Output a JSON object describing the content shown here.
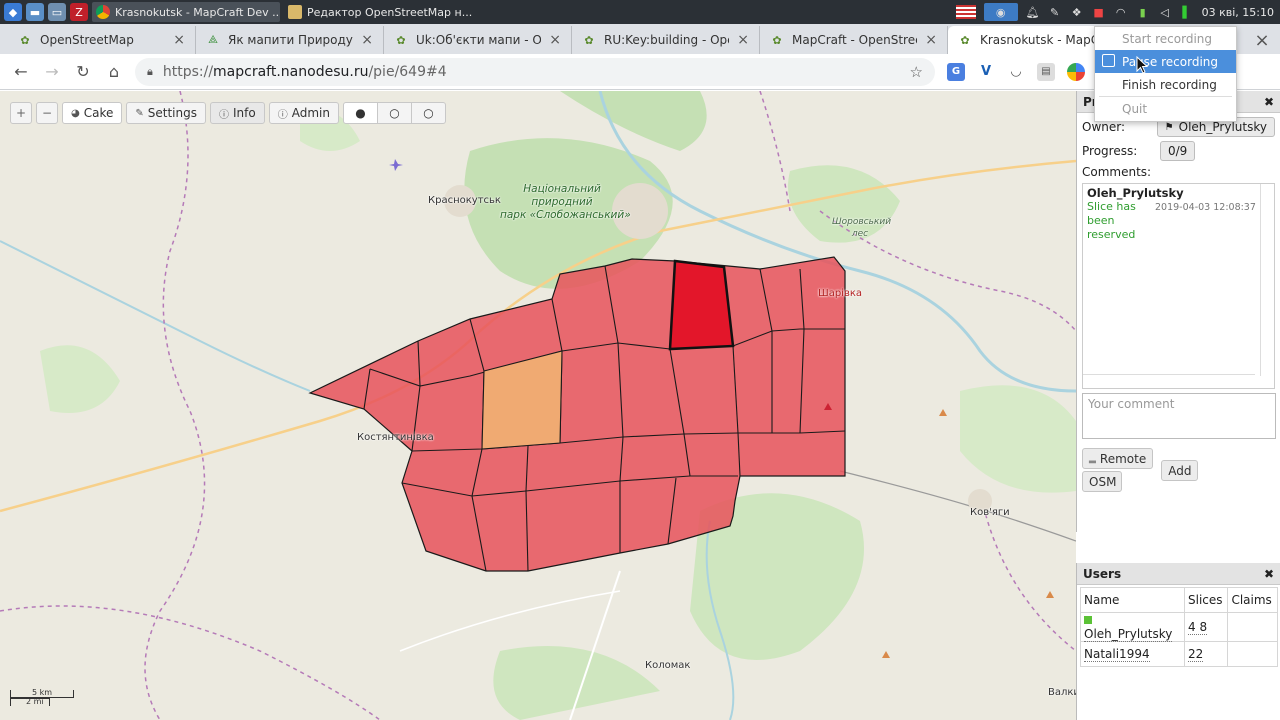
{
  "taskbar": {
    "tasks": [
      {
        "label": "Krasnokutsk - MapCraft Dev ..."
      },
      {
        "label": "Редактор OpenStreetMap н..."
      }
    ],
    "clock": "03 кві, 15:10"
  },
  "tabs": [
    {
      "label": "OpenStreetMap"
    },
    {
      "label": "Як мапити Природу в "
    },
    {
      "label": "Uk:Об'єкти мапи - Ope"
    },
    {
      "label": "RU:Key:building - OpenS"
    },
    {
      "label": "MapCraft - OpenStreetM"
    },
    {
      "label": "Krasnokutsk - MapCraft"
    }
  ],
  "address": {
    "scheme": "https://",
    "host": "mapcraft.nanodesu.ru",
    "path": "/pie/649#4"
  },
  "map_toolbar": {
    "zoom_in": "+",
    "zoom_out": "−",
    "cake": "Cake",
    "settings": "Settings",
    "info": "Info",
    "admin": "Admin",
    "seg": [
      "●",
      "○",
      "○"
    ]
  },
  "map_labels": {
    "krasnokutsk": "Краснокутськ",
    "park_line1": "Національний",
    "park_line2": "природний",
    "park_line3": "парк «Слобожанський»",
    "forest_line1": "Шоровський",
    "forest_line2": "лес",
    "sharivka": "Шарівка",
    "kostiantynivka": "Костянтинівка",
    "koviagi": "Ков'яги",
    "kolomak": "Коломак",
    "valky": "Валки"
  },
  "scale": {
    "km": "5 km",
    "mi": "2 mi"
  },
  "slice_panel": {
    "title": "Pr",
    "owner_label": "Owner:",
    "owner_value": "Oleh_Prylutsky",
    "progress_label": "Progress:",
    "progress_value": "0/9",
    "comments_label": "Comments:",
    "comments": [
      {
        "author": "Oleh_Prylutsky",
        "text": "Slice has been reserved",
        "time": "2019-04-03 12:08:37"
      }
    ],
    "comment_placeholder": "Your comment",
    "remote_button": "Remote",
    "osm_button": "OSM",
    "add_button": "Add"
  },
  "users_panel": {
    "title": "Users",
    "columns": [
      "Name",
      "Slices",
      "Claims"
    ],
    "rows": [
      {
        "name": "Oleh_Prylutsky",
        "slices": "4 8",
        "claims": "",
        "online": true
      },
      {
        "name": "Natali1994",
        "slices": "22",
        "claims": "",
        "online": false
      }
    ]
  },
  "recording_menu": {
    "items": [
      "Start recording",
      "Pause recording",
      "Finish recording",
      "Quit"
    ]
  },
  "colors": {
    "slice_fill": "#e8525a",
    "slice_selected": "#e3162a",
    "slice_orange": "#f0aa72",
    "comment_green": "#2e9d2e",
    "menu_highlight": "#4b8fdc"
  }
}
